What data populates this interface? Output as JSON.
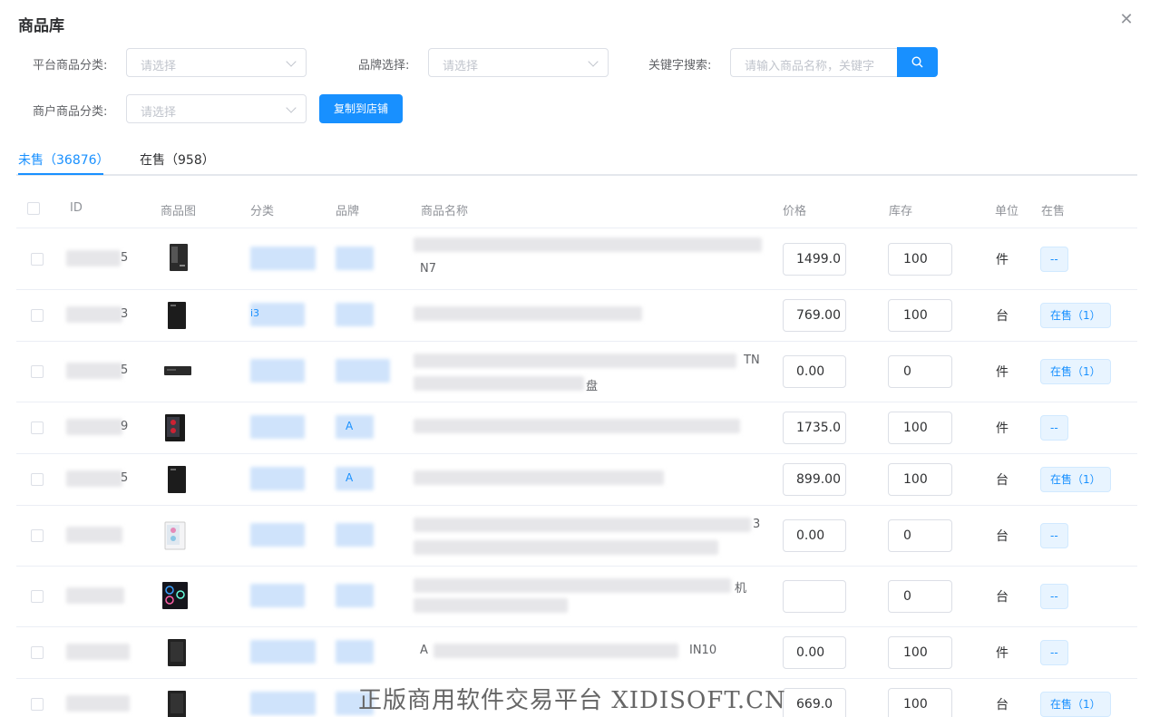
{
  "dialog": {
    "title": "商品库"
  },
  "filters": {
    "platform_category_label": "平台商品分类:",
    "platform_category_placeholder": "请选择",
    "brand_label": "品牌选择:",
    "brand_placeholder": "请选择",
    "keyword_label": "关键字搜索:",
    "keyword_placeholder": "请输入商品名称，关键字",
    "merchant_category_label": "商户商品分类:",
    "merchant_category_placeholder": "请选择",
    "copy_button": "复制到店铺"
  },
  "tabs": [
    {
      "label": "未售（36876）",
      "active": true
    },
    {
      "label": "在售（958）",
      "active": false
    }
  ],
  "table": {
    "headers": [
      "ID",
      "商品图",
      "分类",
      "品牌",
      "商品名称",
      "价格",
      "库存",
      "单位",
      "在售"
    ],
    "rows": [
      {
        "id_suffix": "5",
        "category": "",
        "brand": "",
        "name": "N7",
        "price": "1499.0",
        "stock": "100",
        "unit": "件",
        "status": "--"
      },
      {
        "id_suffix": "3",
        "category": "i3",
        "brand": "",
        "name": "",
        "price": "769.00",
        "stock": "100",
        "unit": "台",
        "status": "在售（1）"
      },
      {
        "id_suffix": "5",
        "category": "",
        "brand": "",
        "name": "TN",
        "name2": "盘",
        "price": "0.00",
        "stock": "0",
        "unit": "件",
        "status": "在售（1）"
      },
      {
        "id_suffix": "9",
        "category": "",
        "brand": "A",
        "name": "",
        "price": "1735.0",
        "stock": "100",
        "unit": "件",
        "status": "--"
      },
      {
        "id_suffix": "5",
        "category": "",
        "brand": "A",
        "name": "",
        "price": "899.00",
        "stock": "100",
        "unit": "台",
        "status": "在售（1）"
      },
      {
        "id_suffix": "",
        "category": "",
        "brand": "",
        "name": "3",
        "price": "0.00",
        "stock": "0",
        "unit": "台",
        "status": "--"
      },
      {
        "id_suffix": "",
        "category": "",
        "brand": "",
        "name": "机",
        "price": "",
        "stock": "0",
        "unit": "台",
        "status": "--"
      },
      {
        "id_suffix": "",
        "category": "",
        "brand": "",
        "name": "A",
        "name2": "IN10",
        "price": "0.00",
        "stock": "100",
        "unit": "件",
        "status": "--"
      },
      {
        "id_suffix": "",
        "category": "",
        "brand": "",
        "name": "",
        "price": "669.0",
        "stock": "100",
        "unit": "台",
        "status": "在售（1）"
      }
    ]
  },
  "watermark": "正版商用软件交易平台 XIDISOFT.CN",
  "colors": {
    "primary": "#1890ff",
    "border": "#dcdfe6",
    "tag_bg": "#e8f4ff"
  }
}
